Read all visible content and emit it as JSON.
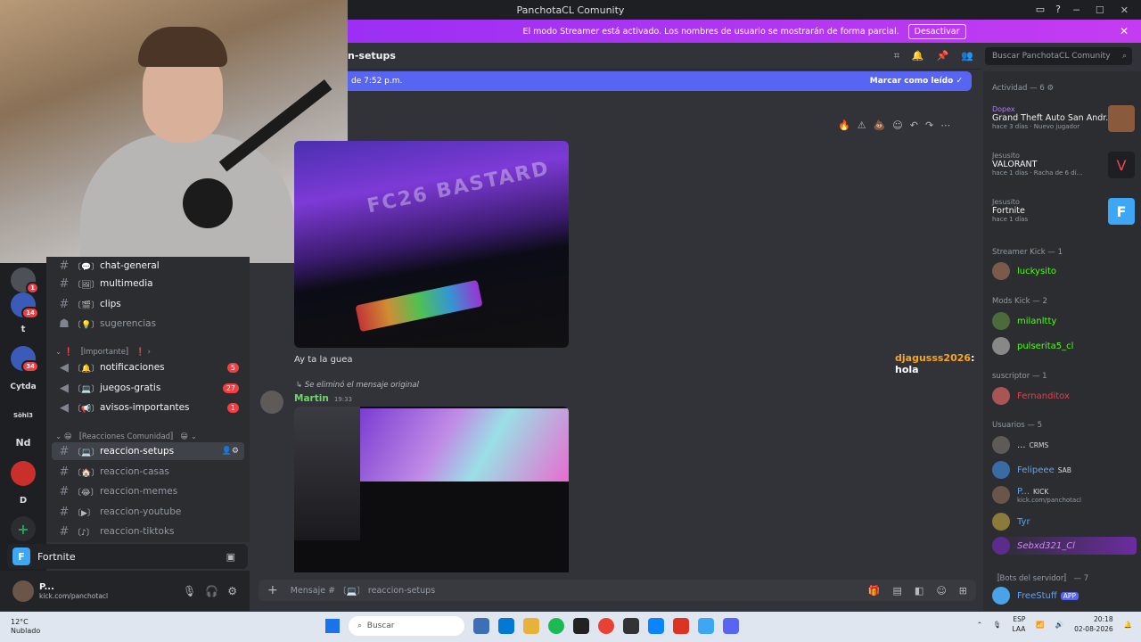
{
  "window": {
    "title": "PanchotaCL Comunity"
  },
  "streamer_banner": {
    "text": "El modo Streamer está activado. Los nombres de usuario se mostrarán de forma parcial.",
    "button": "Desactivar"
  },
  "channel_header": {
    "name": "n-setups"
  },
  "search": {
    "placeholder": "Buscar PanchotaCL Comunity"
  },
  "new_messages": {
    "time_text": "de 7:52 p.m.",
    "mark_read": "Marcar como leído"
  },
  "rail": {
    "items": [
      {
        "label": "",
        "badge": "1"
      },
      {
        "label": "",
        "badge": "14"
      },
      {
        "label": "t",
        "badge": ""
      },
      {
        "label": "",
        "badge": "34"
      },
      {
        "label": "Cytda",
        "badge": ""
      },
      {
        "label": "Söhl3",
        "badge": ""
      },
      {
        "label": "Nd",
        "badge": ""
      },
      {
        "label": "",
        "badge": ""
      },
      {
        "label": "D",
        "badge": ""
      },
      {
        "label": "+",
        "badge": ""
      }
    ]
  },
  "channels": {
    "top": [
      {
        "name": "chat-general",
        "badge": ""
      },
      {
        "name": "multimedia",
        "badge": ""
      },
      {
        "name": "clips",
        "badge": ""
      },
      {
        "name": "sugerencias",
        "badge": ""
      }
    ],
    "cat_importante": "〚Importante〛",
    "importante": [
      {
        "name": "notificaciones",
        "badge": "5"
      },
      {
        "name": "juegos-gratis",
        "badge": "27"
      },
      {
        "name": "avisos-importantes",
        "badge": "1"
      }
    ],
    "cat_reacciones": "〚Reacciones Comunidad〛",
    "reacciones": [
      {
        "name": "reaccion-setups"
      },
      {
        "name": "reaccion-casas"
      },
      {
        "name": "reaccion-memes"
      },
      {
        "name": "reaccion-youtube"
      },
      {
        "name": "reaccion-tiktoks"
      }
    ]
  },
  "activity_bar": {
    "game": "Fortnite"
  },
  "user_panel": {
    "name": "P...",
    "status": "kick.com/panchotacl"
  },
  "messages": {
    "caption1": "Ay ta la guea",
    "reply_text": "Se eliminó el mensaje original",
    "author": "Martin",
    "time": "19:33",
    "small_time": "19:33"
  },
  "overlay": {
    "user": "djagusss2026",
    "text": ": hola"
  },
  "composer": {
    "placeholder": "Mensaje #",
    "channel": "reaccion-setups"
  },
  "members": {
    "activity_title": "Actividad — 6",
    "activities": [
      {
        "who": "Dopex",
        "game": "Grand Theft Auto San Andr...",
        "meta": "hace 3 días · Nuevo jugador"
      },
      {
        "who": "Jesusito",
        "game": "VALORANT",
        "meta": "hace 1 días · Racha de 6 dí..."
      },
      {
        "who": "Jesusito",
        "game": "Fortnite",
        "meta": "hace 1 días"
      }
    ],
    "group_kick": "Streamer Kick — 1",
    "kick_members": [
      "luckysito"
    ],
    "group_mods": "Mods Kick — 2",
    "mods_members": [
      "milanltty",
      "pulserita5_cl"
    ],
    "group_sus": "suscriptor — 1",
    "sus_members": [
      "Fernanditox"
    ],
    "group_users": "Usuarios — 5",
    "user_members": [
      {
        "name": "...",
        "tag": "CRMS"
      },
      {
        "name": "Felipeee",
        "tag": "SAB"
      },
      {
        "name": "P...",
        "tag": "KICK",
        "sub": "kick.com/panchotacl"
      },
      {
        "name": "Tyr",
        "tag": ""
      },
      {
        "name": "Sebxd321_Cl",
        "tag": ""
      }
    ],
    "group_bots": "〚Bots del servidor〛 — 7",
    "bot_members": [
      {
        "name": "FreeStuff",
        "tag": "APP"
      }
    ]
  },
  "taskbar": {
    "temp": "12°C",
    "weather": "Nublado",
    "search": "Buscar",
    "lang": "ESP",
    "region": "LAA",
    "time": "20:18",
    "date": "02-08-2026"
  },
  "colors": {
    "banner": "#c43cf2",
    "accent": "#5865f2",
    "kick_green": "#53fc18",
    "online": "#23a55a"
  }
}
